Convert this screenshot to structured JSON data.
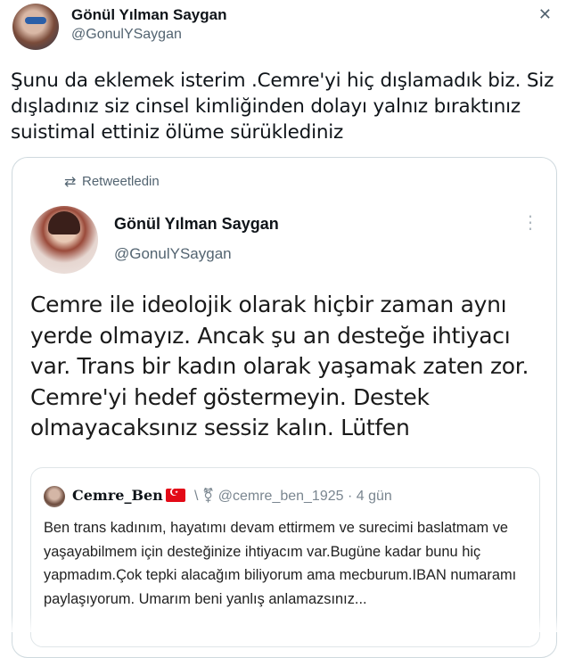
{
  "outer_tweet": {
    "name": "Gönül Yılman Saygan",
    "handle": "@GonulYSaygan",
    "close_glyph": "✕",
    "text": "Şunu da eklemek isterim .Cemre'yi hiç dışlamadık biz. Siz dışladınız siz cinsel kimliğinden dolayı yalnız bıraktınız suistimal ettiniz ölüme sürüklediniz"
  },
  "retweet_card": {
    "retweet_label": "Retweetledin",
    "retweet_icon": "retweet-icon",
    "name": "Gönül Yılman Saygan",
    "handle": "@GonulYSaygan",
    "more_glyph": "⋮",
    "text": "Cemre ile ideolojik olarak hiçbir zaman aynı yerde olmayız. Ancak şu an desteğe ihtiyacı var. Trans bir kadın olarak yaşamak zaten zor. Cemre'yi hedef göstermeyin. Destek olmayacaksınız sessiz kalın. Lütfen"
  },
  "quoted_tweet": {
    "name": "Cemre_Ben",
    "flag_icon": "turkey-flag-icon",
    "meta": "\\ ⚧ @cemre_ben_1925 · 4 gün",
    "text": "Ben trans kadınım, hayatımı devam ettirmem ve surecimi baslatmam ve yaşayabilmem için desteğinize ihtiyacım var.Bugüne kadar bunu hiç yapmadım.Çok tepki alacağım biliyorum ama mecburum.IBAN numaramı paylaşıyorum. Umarım beni yanlış anlamazsınız..."
  },
  "colors": {
    "text": "#0f1419",
    "secondary": "#536471",
    "border": "#cfd9de",
    "flag_red": "#e30a17"
  }
}
